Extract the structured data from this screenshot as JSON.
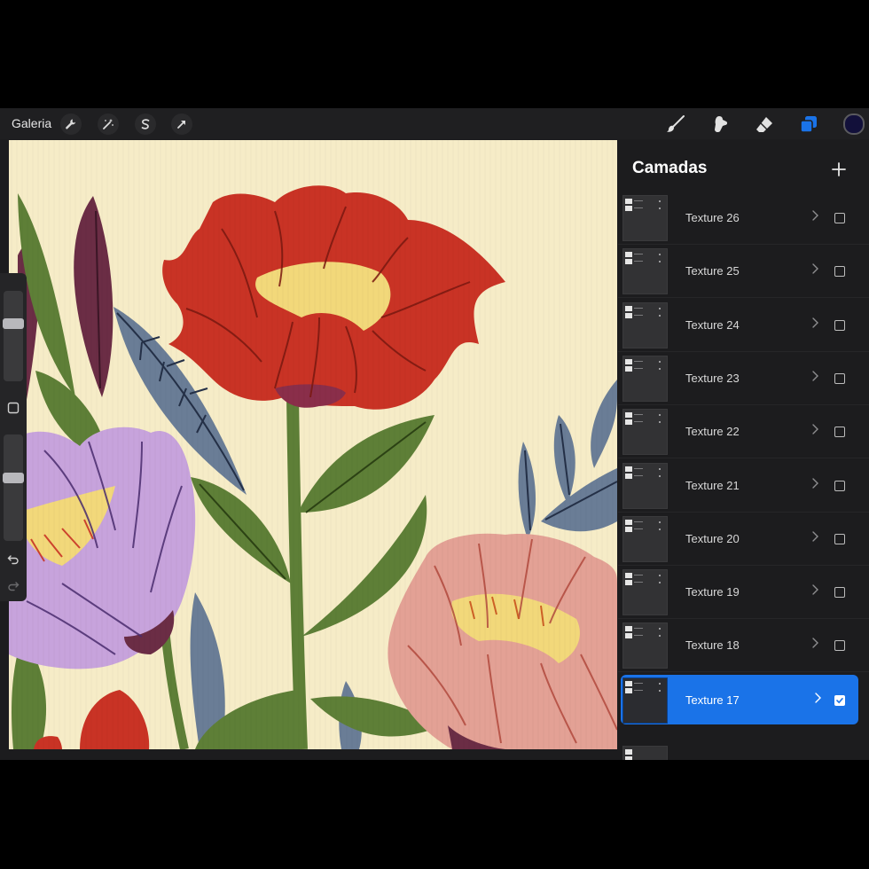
{
  "toolbar": {
    "gallery_label": "Galeria",
    "left_tools": [
      "wrench-icon",
      "magic-wand-icon",
      "selection-s-icon",
      "transform-arrow-icon"
    ],
    "right_tools": [
      "brush-icon",
      "smudge-icon",
      "eraser-icon",
      "layers-icon"
    ],
    "active_tool": "layers-icon",
    "current_color": "#12103a",
    "accent_color": "#1a73e8"
  },
  "sidebar": {
    "size_slider_level": 0.35,
    "opacity_slider_level": 0.4,
    "icons": [
      "modify-square-icon",
      "undo-icon",
      "redo-icon"
    ]
  },
  "layers_panel": {
    "title": "Camadas",
    "add_icon": "plus-icon",
    "layers": [
      {
        "name": "Texture 26",
        "visible": false,
        "selected": false
      },
      {
        "name": "Texture 25",
        "visible": false,
        "selected": false
      },
      {
        "name": "Texture 24",
        "visible": false,
        "selected": false
      },
      {
        "name": "Texture 23",
        "visible": false,
        "selected": false
      },
      {
        "name": "Texture 22",
        "visible": false,
        "selected": false
      },
      {
        "name": "Texture 21",
        "visible": false,
        "selected": false
      },
      {
        "name": "Texture 20",
        "visible": false,
        "selected": false
      },
      {
        "name": "Texture 19",
        "visible": false,
        "selected": false
      },
      {
        "name": "Texture 18",
        "visible": false,
        "selected": false
      },
      {
        "name": "Texture 17",
        "visible": true,
        "selected": true
      }
    ]
  },
  "canvas": {
    "background_color": "#f6ecc7",
    "colors": {
      "red": "#c93325",
      "lilac": "#c7a3dc",
      "pink": "#e3a195",
      "green": "#5e7f37",
      "blue_grey": "#6a7d96",
      "plum": "#6b2d45",
      "yellow": "#f2d87a"
    }
  }
}
